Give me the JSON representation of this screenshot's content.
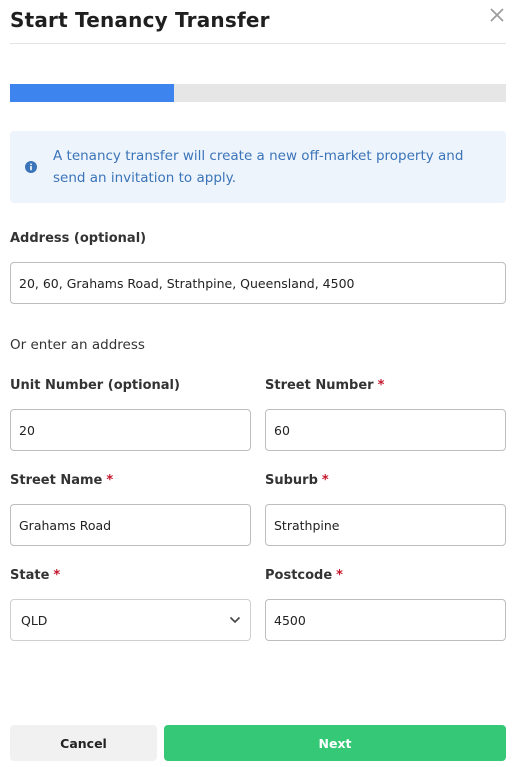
{
  "header": {
    "title": "Start Tenancy Transfer"
  },
  "progress": {
    "fraction": 0.33
  },
  "info": {
    "text": "A tenancy transfer will create a new off-market property and send an invitation to apply."
  },
  "address": {
    "label": "Address (optional)",
    "value": "20, 60, Grahams Road, Strathpine, Queensland, 4500"
  },
  "alt_text": "Or enter an address",
  "fields": {
    "unit_number": {
      "label": "Unit Number (optional)",
      "value": "20"
    },
    "street_number": {
      "label": "Street Number",
      "value": "60",
      "required_mark": "*"
    },
    "street_name": {
      "label": "Street Name",
      "value": "Grahams Road",
      "required_mark": "*"
    },
    "suburb": {
      "label": "Suburb",
      "value": "Strathpine",
      "required_mark": "*"
    },
    "state": {
      "label": "State",
      "value": "QLD",
      "required_mark": "*"
    },
    "postcode": {
      "label": "Postcode",
      "value": "4500",
      "required_mark": "*"
    }
  },
  "buttons": {
    "cancel": "Cancel",
    "next": "Next"
  },
  "colors": {
    "accent_blue": "#3d84ef",
    "next_green": "#35c977",
    "required_red": "#c4162b",
    "info_bg": "#edf4fc"
  },
  "icons": {
    "close": "close-icon",
    "info": "info-icon",
    "select": "chevron-down-icon"
  }
}
